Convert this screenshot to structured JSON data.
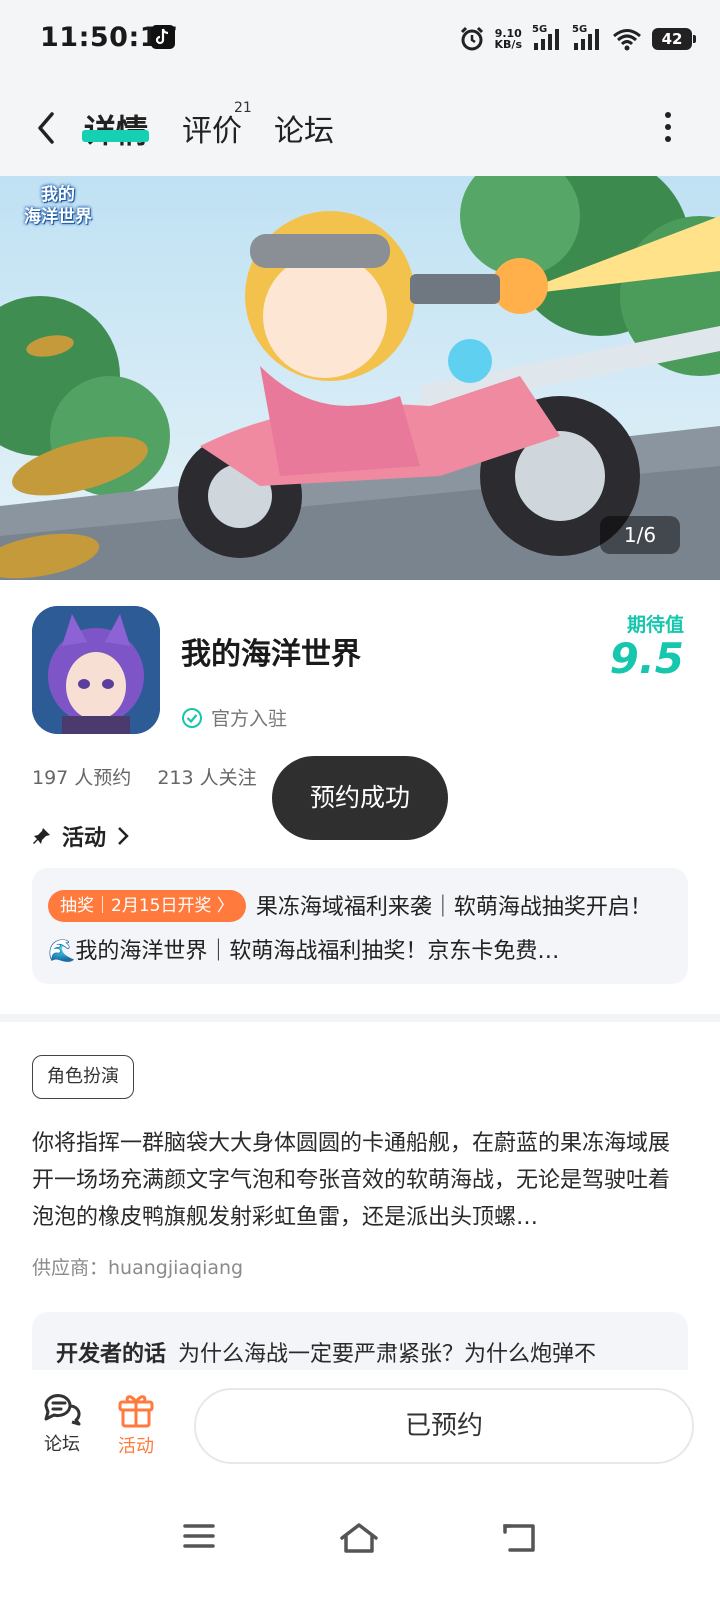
{
  "status_bar": {
    "time": "11:50:17",
    "net_speed_value": "9.10",
    "net_speed_unit": "KB/s",
    "signal1_label": "5G",
    "signal2_label": "5G",
    "battery": "42",
    "icons": [
      "tiktok-icon",
      "alarm-icon",
      "signal-icon",
      "signal-icon",
      "wifi-icon",
      "battery-icon"
    ]
  },
  "header": {
    "tabs": [
      {
        "label": "详情",
        "active": true
      },
      {
        "label": "评价",
        "badge": "21"
      },
      {
        "label": "论坛"
      }
    ],
    "accent_color": "#16d0b4"
  },
  "banner": {
    "logo_text": "我的\n海洋世界",
    "pager": "1/6"
  },
  "app": {
    "name": "我的海洋世界",
    "official_label": "官方入驻",
    "expect_label": "期待值",
    "expect_value": "9.5",
    "reservations": "197 人预约",
    "followers": "213 人关注"
  },
  "toast": "预约成功",
  "activity": {
    "title": "活动",
    "tag": "抽奖｜2月15日开奖 〉",
    "text": "果冻海域福利来袭｜软萌海战抽奖开启！ 🌊我的海洋世界｜软萌海战福利抽奖！京东卡免费…"
  },
  "details": {
    "genre": "角色扮演",
    "description": "你将指挥一群脑袋大大身体圆圆的卡通船舰，在蔚蓝的果冻海域展开一场场充满颜文字气泡和夸张音效的软萌海战，无论是驾驶吐着泡泡的橡皮鸭旗舰发射彩虹鱼雷，还是派出头顶螺…",
    "supplier": "供应商：huangjiaqiang",
    "dev_title": "开发者的话",
    "dev_text": "为什么海战一定要严肃紧张？为什么炮弹不"
  },
  "bottom_bar": {
    "forum_label": "论坛",
    "activity_label": "活动",
    "reserve_label": "已预约",
    "activity_color": "#ff7a3c"
  }
}
